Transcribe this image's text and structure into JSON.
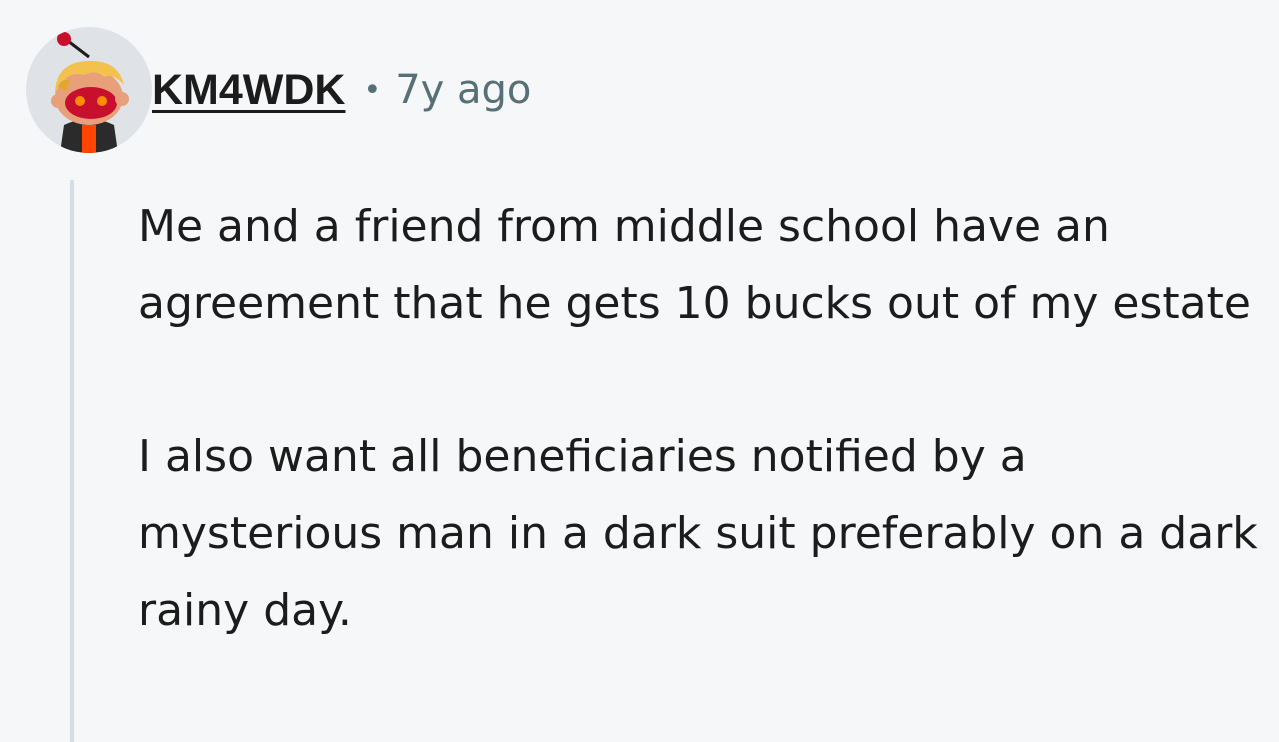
{
  "comment": {
    "author": "KM4WDK",
    "separator": "•",
    "timestamp": "7y ago",
    "paragraphs": [
      "Me and a friend from middle school have an agreement that he gets 10 bucks out of my estate",
      "I also want all beneficiaries notified by a mysterious man in a dark suit preferably on a dark rainy day."
    ]
  },
  "colors": {
    "background": "#f6f7f8",
    "text": "#1c1c1c",
    "meta": "#576f76",
    "thread_line": "#d6dde3"
  },
  "icons": {
    "avatar": "snoo-avatar-icon"
  }
}
